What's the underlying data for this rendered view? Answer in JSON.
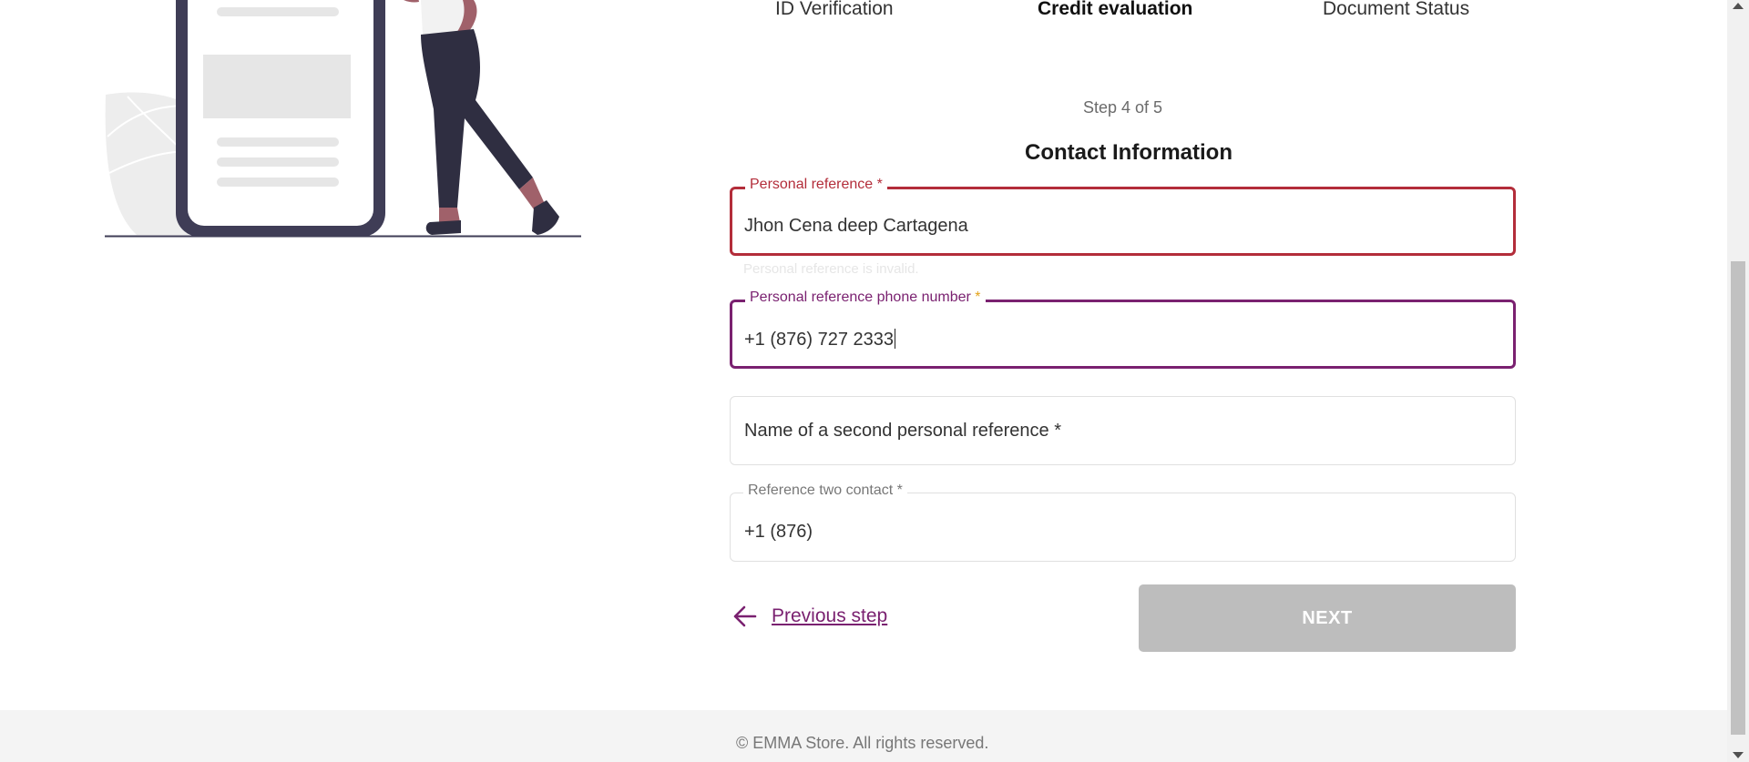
{
  "stepper": {
    "tabs": [
      {
        "label": "ID Verification",
        "active": false
      },
      {
        "label": "Credit evaluation",
        "active": true
      },
      {
        "label": "Document Status",
        "active": false
      }
    ],
    "step_count": "Step 4 of 5"
  },
  "form": {
    "title": "Contact Information",
    "personal_reference": {
      "label": "Personal reference",
      "required_mark": "*",
      "value": "Jhon Cena deep Cartagena",
      "helper": "Personal reference is invalid."
    },
    "personal_reference_phone": {
      "label": "Personal reference phone number",
      "required_mark": "*",
      "value": "+1 (876) 727 2333"
    },
    "second_reference_name": {
      "placeholder": "Name of a second personal reference *"
    },
    "reference_two_contact": {
      "label": "Reference two contact",
      "required_mark": "*",
      "value": "+1 (876)"
    }
  },
  "actions": {
    "previous_label": "Previous step",
    "next_label": "NEXT"
  },
  "footer": {
    "copyright": "© EMMA Store. All rights reserved."
  },
  "colors": {
    "accent": "#7a2170",
    "error": "#b32d3a",
    "disabled_button": "#bdbdbd",
    "illustration_dark": "#3f3d56"
  },
  "icons": {
    "previous": "arrow-left-icon"
  }
}
